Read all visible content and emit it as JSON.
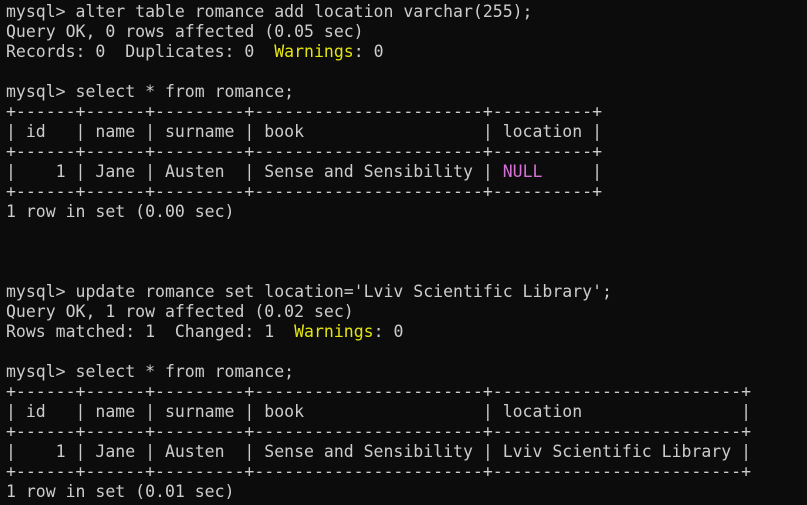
{
  "colors": {
    "background": "#0c0c0c",
    "text": "#cccccc",
    "warning": "#e5e510",
    "null_value": "#d670d6"
  },
  "lines": [
    [
      {
        "text": "mysql> alter table romance add location varchar(255);"
      }
    ],
    [
      {
        "text": "Query OK, 0 rows affected (0.05 sec)"
      }
    ],
    [
      {
        "text": "Records: 0  Duplicates: 0  "
      },
      {
        "text": "Warnings",
        "cls": "warn"
      },
      {
        "text": ": 0"
      }
    ],
    [],
    [
      {
        "text": "mysql> select * from romance;"
      }
    ],
    [
      {
        "text": "+------+------+---------+-----------------------+----------+"
      }
    ],
    [
      {
        "text": "| id   | name | surname | book                  | location |"
      }
    ],
    [
      {
        "text": "+------+------+---------+-----------------------+----------+"
      }
    ],
    [
      {
        "text": "|    1 | Jane | Austen  | Sense and Sensibility | "
      },
      {
        "text": "NULL",
        "cls": "null"
      },
      {
        "text": "     |"
      }
    ],
    [
      {
        "text": "+------+------+---------+-----------------------+----------+"
      }
    ],
    [
      {
        "text": "1 row in set (0.00 sec)"
      }
    ],
    [],
    [],
    [],
    [
      {
        "text": "mysql> update romance set location='Lviv Scientific Library';"
      }
    ],
    [
      {
        "text": "Query OK, 1 row affected (0.02 sec)"
      }
    ],
    [
      {
        "text": "Rows matched: 1  Changed: 1  "
      },
      {
        "text": "Warnings",
        "cls": "warn"
      },
      {
        "text": ": 0"
      }
    ],
    [],
    [
      {
        "text": "mysql> select * from romance;"
      }
    ],
    [
      {
        "text": "+------+------+---------+-----------------------+-------------------------+"
      }
    ],
    [
      {
        "text": "| id   | name | surname | book                  | location                |"
      }
    ],
    [
      {
        "text": "+------+------+---------+-----------------------+-------------------------+"
      }
    ],
    [
      {
        "text": "|    1 | Jane | Austen  | Sense and Sensibility | Lviv Scientific Library |"
      }
    ],
    [
      {
        "text": "+------+------+---------+-----------------------+-------------------------+"
      }
    ],
    [
      {
        "text": "1 row in set (0.01 sec)"
      }
    ]
  ]
}
